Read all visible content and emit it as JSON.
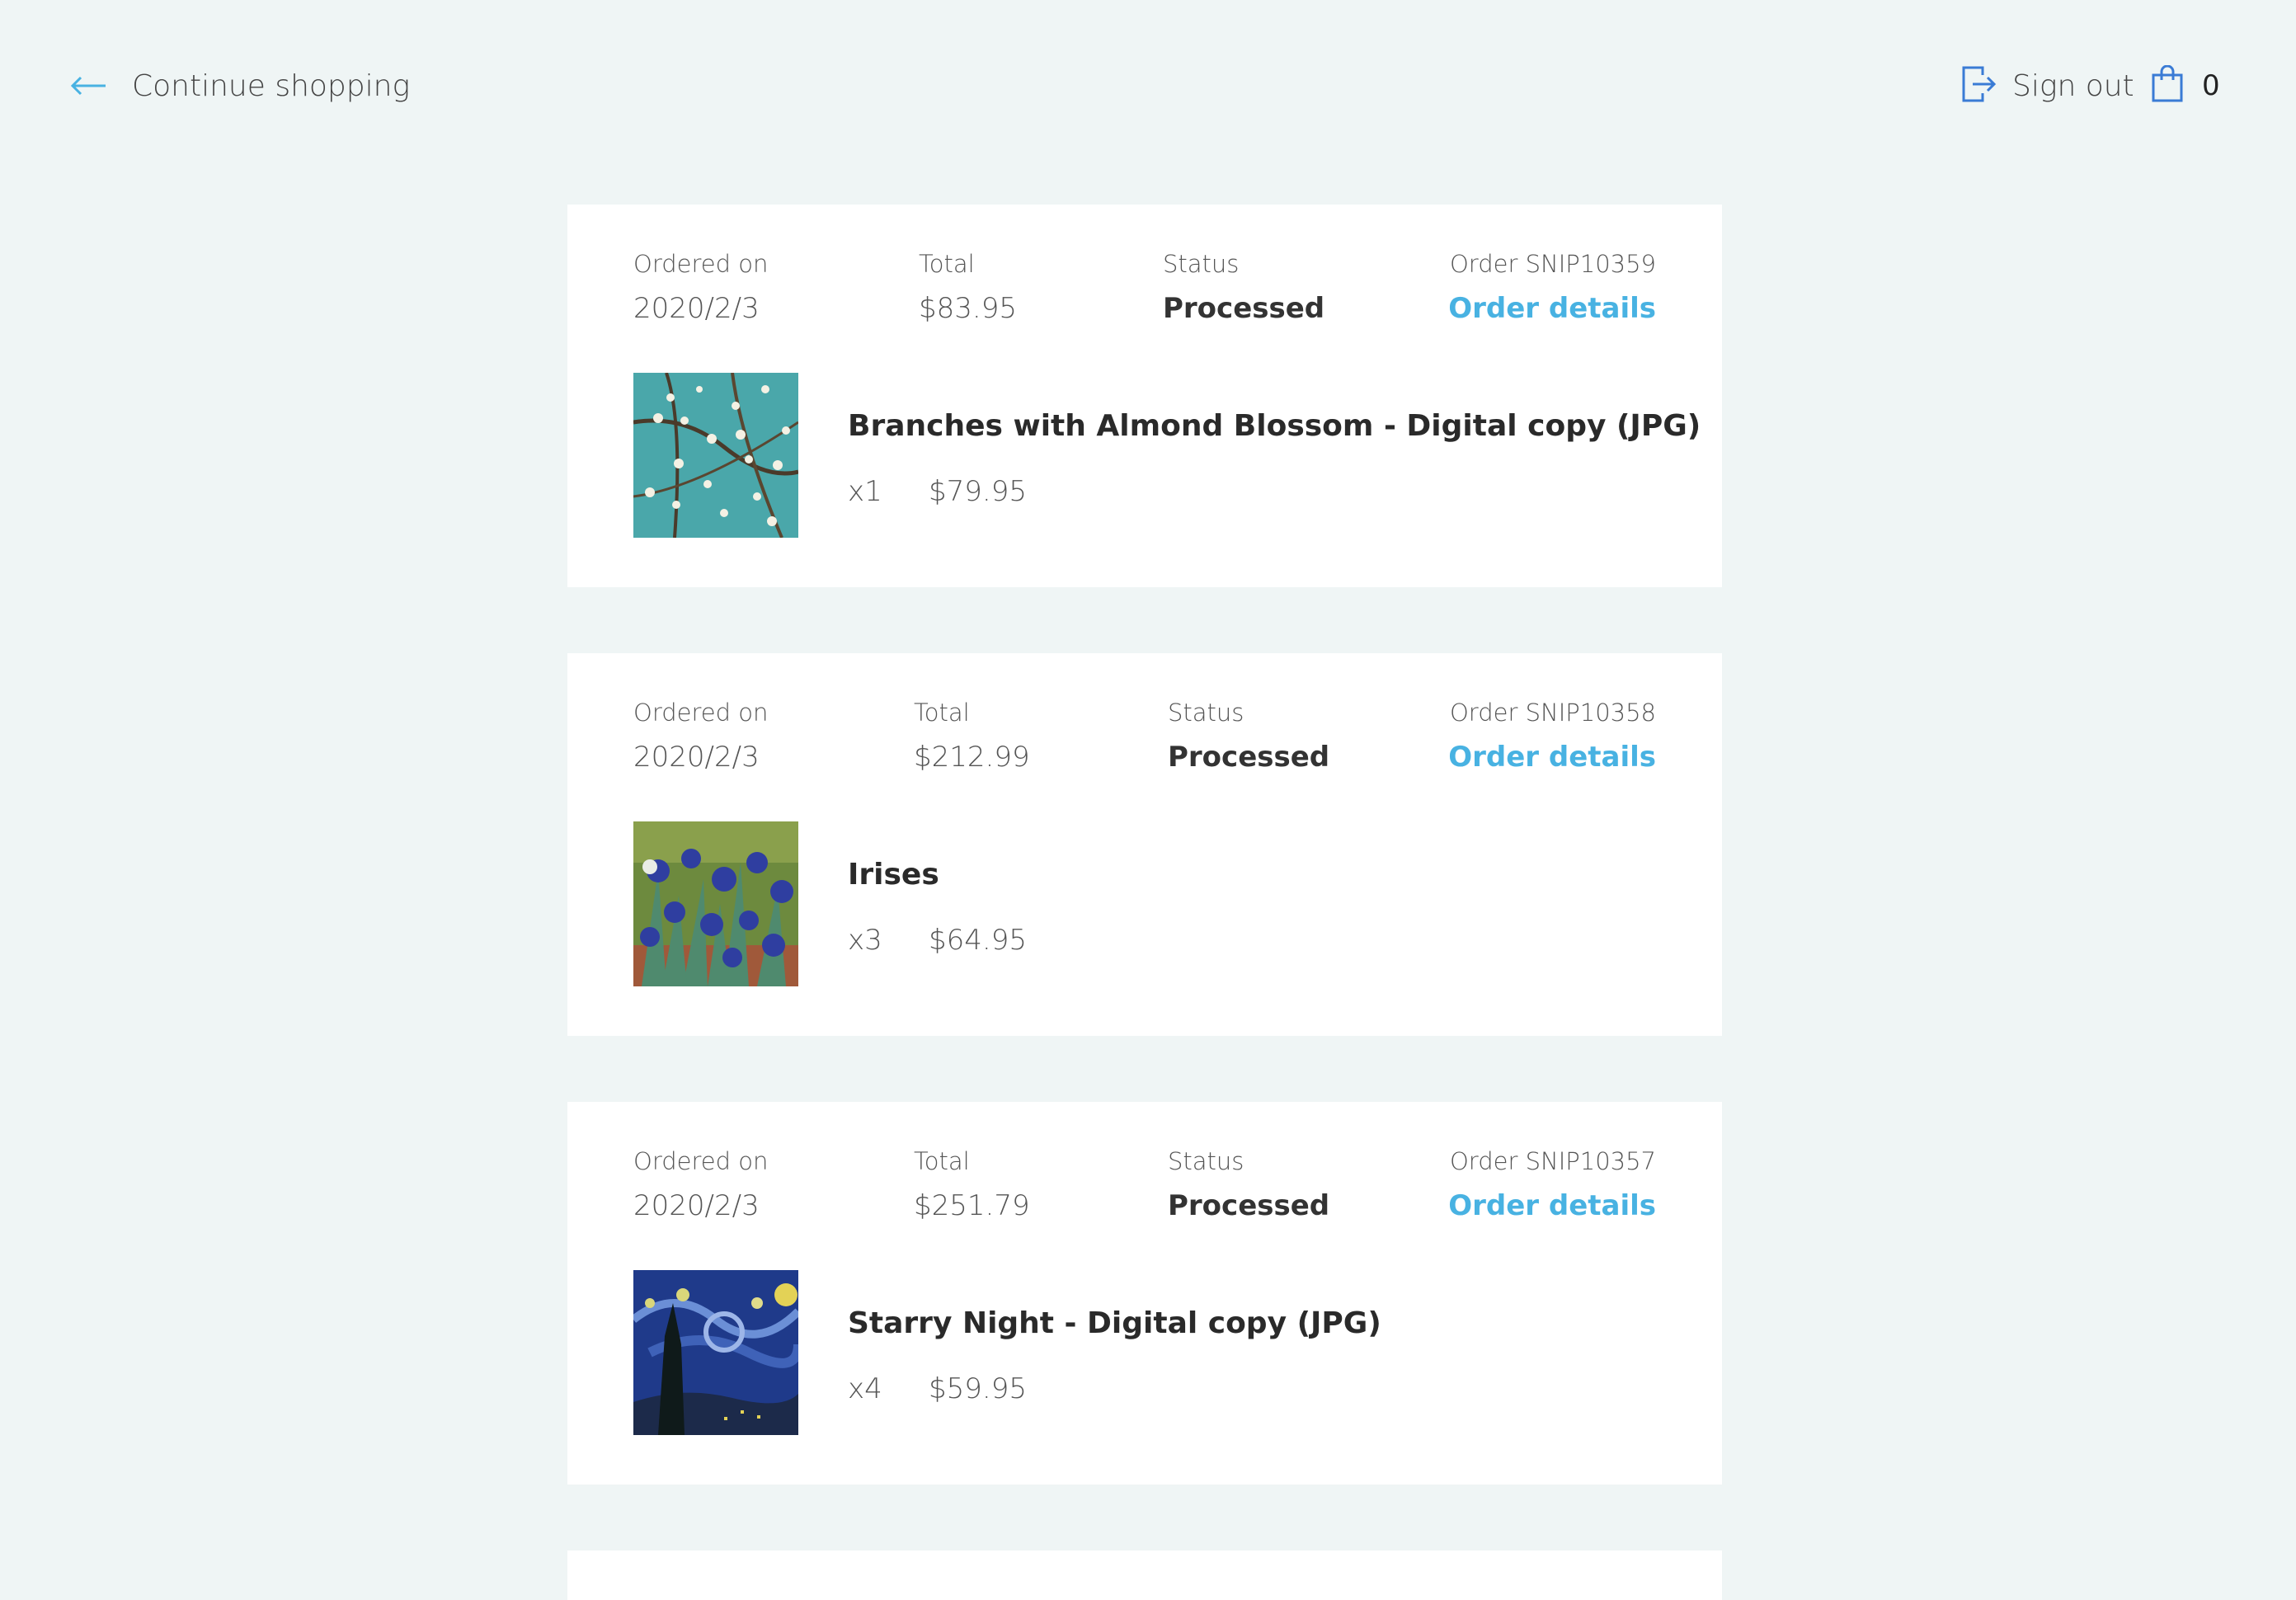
{
  "header": {
    "back_label": "Continue shopping",
    "signout_label": "Sign out",
    "cart_count": "0"
  },
  "labels": {
    "ordered_on": "Ordered on",
    "total": "Total",
    "status": "Status",
    "order_details": "Order details"
  },
  "orders": [
    {
      "date": "2020/2/3",
      "total": "$83.95",
      "status": "Processed",
      "order_id": "Order SNIP10359",
      "item": {
        "title": "Branches with Almond Blossom - Digital copy (JPG)",
        "qty": "x1",
        "price": "$79.95",
        "image": "almond-blossom-thumbnail"
      }
    },
    {
      "date": "2020/2/3",
      "total": "$212.99",
      "status": "Processed",
      "order_id": "Order SNIP10358",
      "item": {
        "title": "Irises",
        "qty": "x3",
        "price": "$64.95",
        "image": "irises-thumbnail"
      }
    },
    {
      "date": "2020/2/3",
      "total": "$251.79",
      "status": "Processed",
      "order_id": "Order SNIP10357",
      "item": {
        "title": "Starry Night - Digital copy (JPG)",
        "qty": "x4",
        "price": "$59.95",
        "image": "starry-night-thumbnail"
      }
    }
  ],
  "colors": {
    "background": "#eff5f5",
    "card": "#ffffff",
    "link": "#48b2e2",
    "icon": "#3a7bd5"
  },
  "icons": [
    "arrow-left-icon",
    "sign-out-icon",
    "shopping-bag-icon"
  ]
}
